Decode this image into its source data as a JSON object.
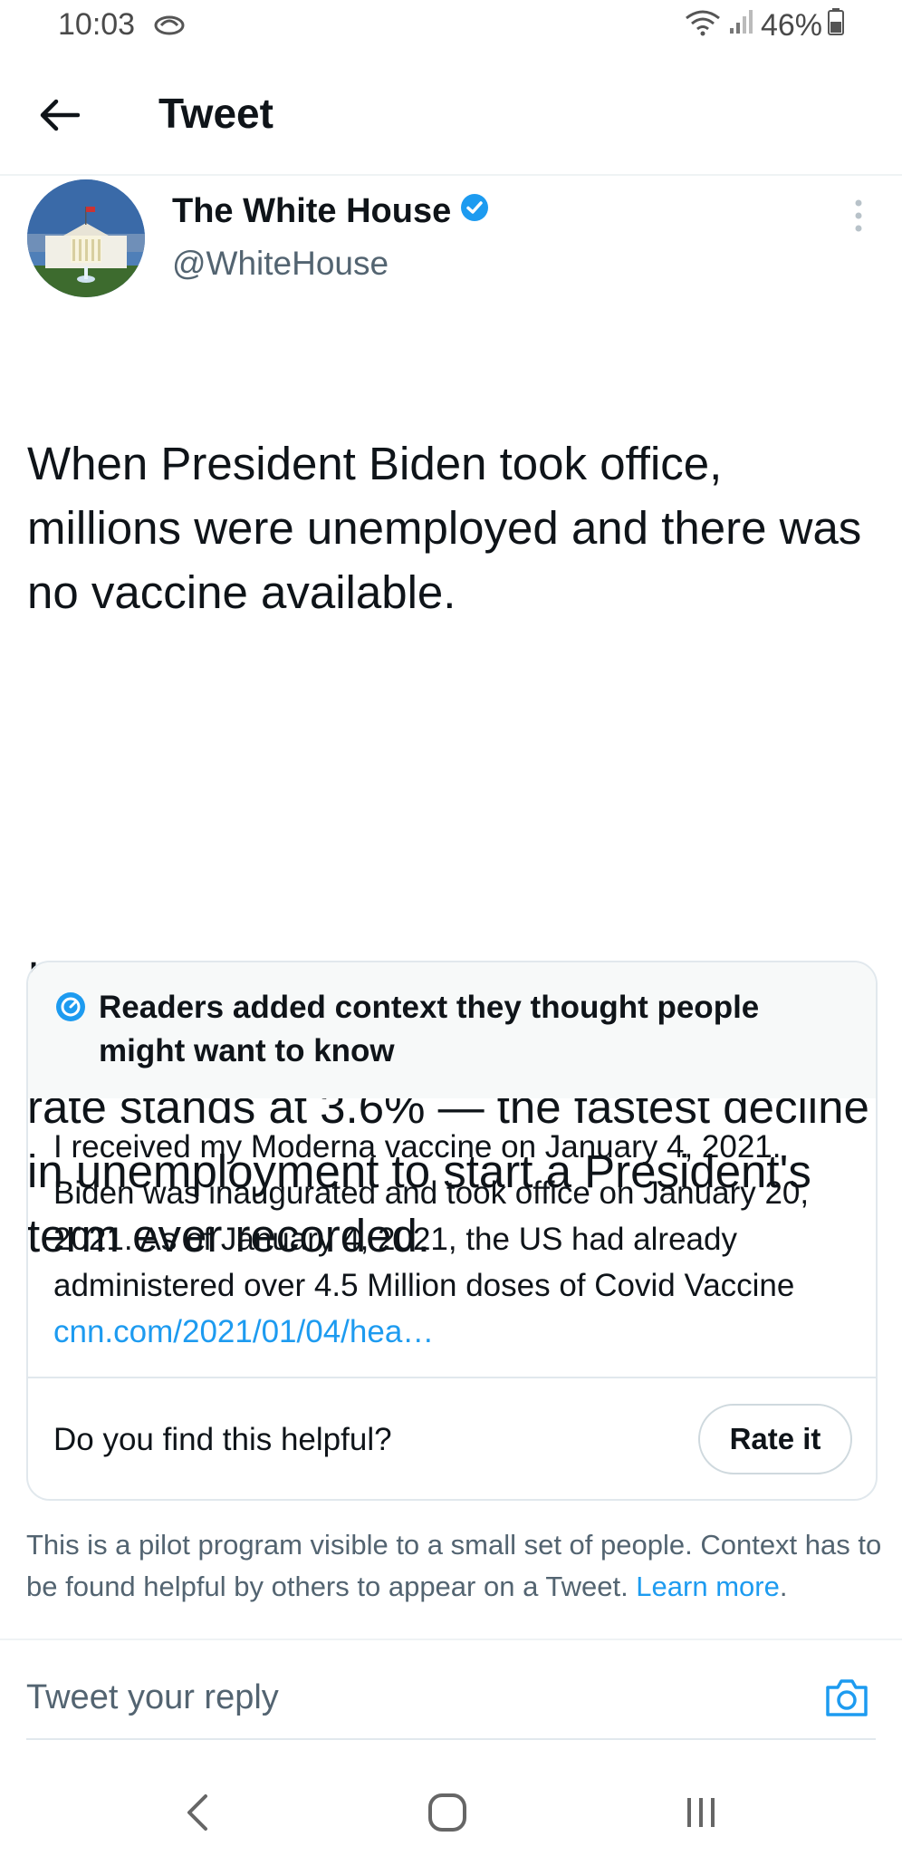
{
  "status_bar": {
    "time": "10:03",
    "battery": "46%"
  },
  "header": {
    "title": "Tweet"
  },
  "tweet": {
    "author_name": "The White House",
    "author_handle": "@WhiteHouse",
    "paragraph1": "When President Biden took office, millions were unemployed and there was no vaccine available.",
    "paragraph2": "In the last 15 months, the economy has created 8.3M jobs and the unemployment rate stands at 3.6% — the fastest decline in unemployment to start a President's term ever recorded."
  },
  "note": {
    "header": "Readers added context they thought people might want to know",
    "body": "I received my Moderna vaccine on January 4, 2021.  Biden was inaugurated and took office on January 20, 2021.  As of January 4, 2021, the US had already administered over 4.5 Million doses of Covid Vaccine ",
    "link": "cnn.com/2021/01/04/hea…",
    "helpful_question": "Do you find this helpful?",
    "rate_button": "Rate it"
  },
  "pilot": {
    "text": "This is a pilot program visible to a small set of people. Context has to be found helpful by others to appear on a Tweet. ",
    "link": "Learn more",
    "period": "."
  },
  "reply": {
    "placeholder": "Tweet your reply"
  },
  "colors": {
    "accent": "#1d9bf0",
    "text": "#0f1419",
    "secondary": "#536471",
    "note_header_bg": "#f7f9f9"
  },
  "icons": [
    "back-arrow-icon",
    "verified-badge-icon",
    "more-vertical-icon",
    "community-notes-icon",
    "camera-icon",
    "nav-back-icon",
    "nav-home-icon",
    "nav-recents-icon",
    "wifi-icon",
    "signal-icon",
    "battery-icon",
    "cloud-icon"
  ]
}
